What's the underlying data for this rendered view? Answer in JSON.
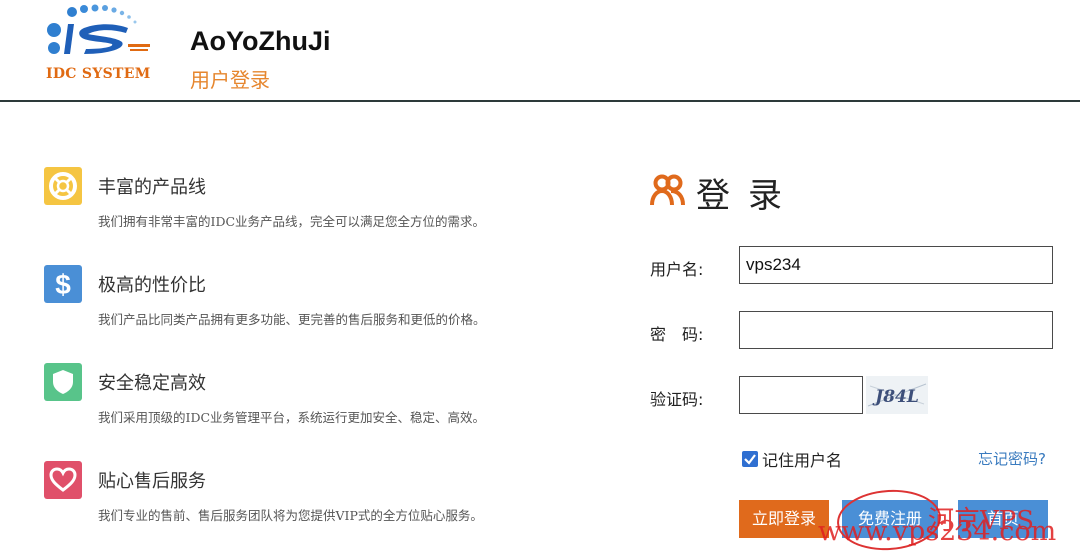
{
  "header": {
    "logo_text": "IDC SYSTEM",
    "title": "AoYoZhuJi",
    "subtitle": "用户登录"
  },
  "features": [
    {
      "title": "丰富的产品线",
      "desc": "我们拥有非常丰富的IDC业务产品线，完全可以满足您全方位的需求。",
      "icon": "lifebuoy-icon",
      "color": "#f5c542"
    },
    {
      "title": "极高的性价比",
      "desc": "我们产品比同类产品拥有更多功能、更完善的售后服务和更低的价格。",
      "icon": "dollar-icon",
      "color": "#4a8fd6"
    },
    {
      "title": "安全稳定高效",
      "desc": "我们采用顶级的IDC业务管理平台，系统运行更加安全、稳定、高效。",
      "icon": "shield-icon",
      "color": "#58c48a"
    },
    {
      "title": "贴心售后服务",
      "desc": "我们专业的售前、售后服务团队将为您提供VIP式的全方位贴心服务。",
      "icon": "heart-icon",
      "color": "#e0506a"
    }
  ],
  "login": {
    "title": "登录",
    "username_label": "用户名:",
    "username_value": "vps234",
    "password_label": "密　码:",
    "captcha_label": "验证码:",
    "captcha_text": "J84L",
    "remember_label": "记住用户名",
    "remember_checked": true,
    "forgot_link": "忘记密码?",
    "login_button": "立即登录",
    "register_button": "免费注册",
    "third_button": "首页",
    "accent_color": "#e06a1c"
  },
  "watermark": {
    "line1": "河京VPS",
    "line2": "www.vps234.com"
  }
}
